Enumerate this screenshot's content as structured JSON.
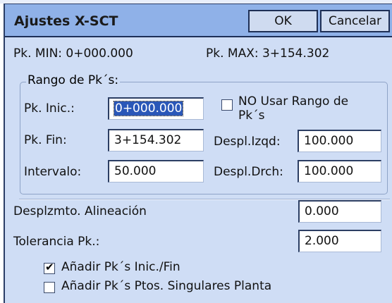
{
  "window": {
    "title": "Ajustes X-SCT"
  },
  "buttons": {
    "ok": "OK",
    "cancel": "Cancelar"
  },
  "info": {
    "pk_min": "Pk. MIN: 0+000.000",
    "pk_max": "Pk. MAX: 3+154.302"
  },
  "rango": {
    "title": "Rango de Pk´s:",
    "pk_inic_label": "Pk. Inic.:",
    "pk_inic_value": "0+000.000",
    "pk_fin_label": "Pk. Fin:",
    "pk_fin_value": "3+154.302",
    "intervalo_label": "Intervalo:",
    "intervalo_value": "50.000",
    "no_usar_label_line1": "NO Usar Rango de",
    "no_usar_label_line2": "Pk´s",
    "no_usar_checked": false,
    "despl_izqd_label": "Despl.Izqd:",
    "despl_izqd_value": "100.000",
    "despl_drch_label": "Despl.Drch:",
    "despl_drch_value": "100.000"
  },
  "alineacion": {
    "label": "Desplzmto. Alineación",
    "value": "0.000"
  },
  "tolerancia": {
    "label": "Tolerancia Pk.:",
    "value": "2.000"
  },
  "options": {
    "anadir_inic_fin": {
      "label": "Añadir Pk´s Inic./Fin",
      "checked": true
    },
    "anadir_singulares": {
      "label": "Añadir Pk´s Ptos. Singulares Planta",
      "checked": false
    }
  },
  "checkmark": "✔"
}
